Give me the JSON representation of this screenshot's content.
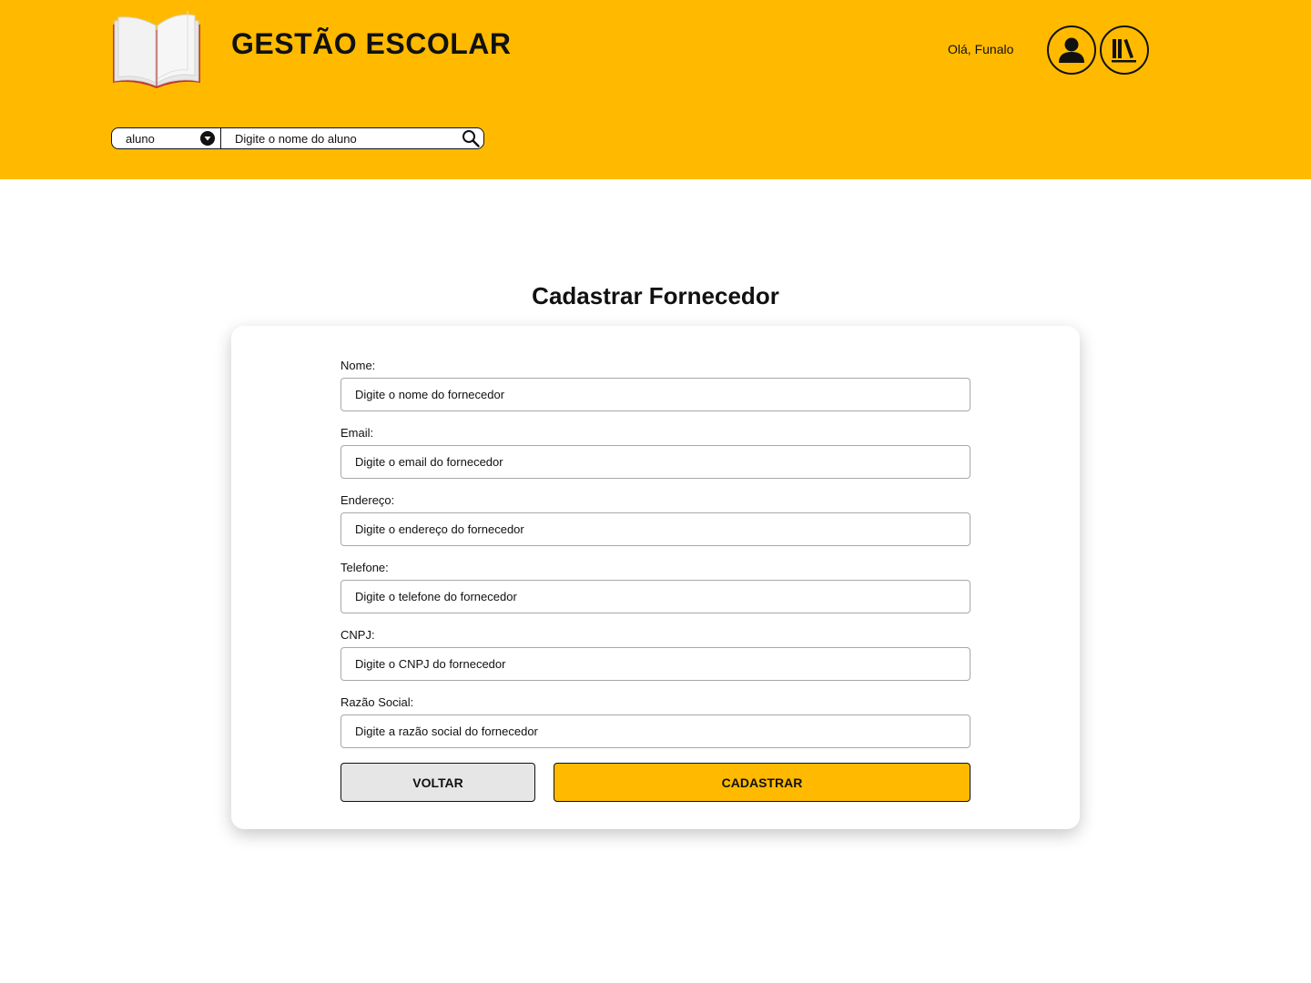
{
  "header": {
    "app_title": "GESTÃO ESCOLAR",
    "greeting": "Olá, Funalo",
    "logo_icon": "open-book-icon",
    "profile_icon": "user-icon",
    "library_icon": "books-icon",
    "accent_color": "#FFBA00"
  },
  "search": {
    "type_selected": "aluno",
    "placeholder": "Digite o nome do aluno",
    "icon": "search-icon"
  },
  "page": {
    "title": "Cadastrar Fornecedor"
  },
  "form": {
    "fields": [
      {
        "label": "Nome:",
        "placeholder": "Digite o nome do fornecedor",
        "value": ""
      },
      {
        "label": "Email:",
        "placeholder": "Digite o email do fornecedor",
        "value": ""
      },
      {
        "label": "Endereço:",
        "placeholder": "Digite o endereço do fornecedor",
        "value": ""
      },
      {
        "label": "Telefone:",
        "placeholder": "Digite o telefone do fornecedor",
        "value": ""
      },
      {
        "label": "CNPJ:",
        "placeholder": "Digite o CNPJ do fornecedor",
        "value": ""
      },
      {
        "label": "Razão Social:",
        "placeholder": "Digite a razão social do fornecedor",
        "value": ""
      }
    ],
    "back_label": "VOLTAR",
    "submit_label": "CADASTRAR",
    "back_color": "#E6E6E6",
    "submit_color": "#FFBA00"
  }
}
